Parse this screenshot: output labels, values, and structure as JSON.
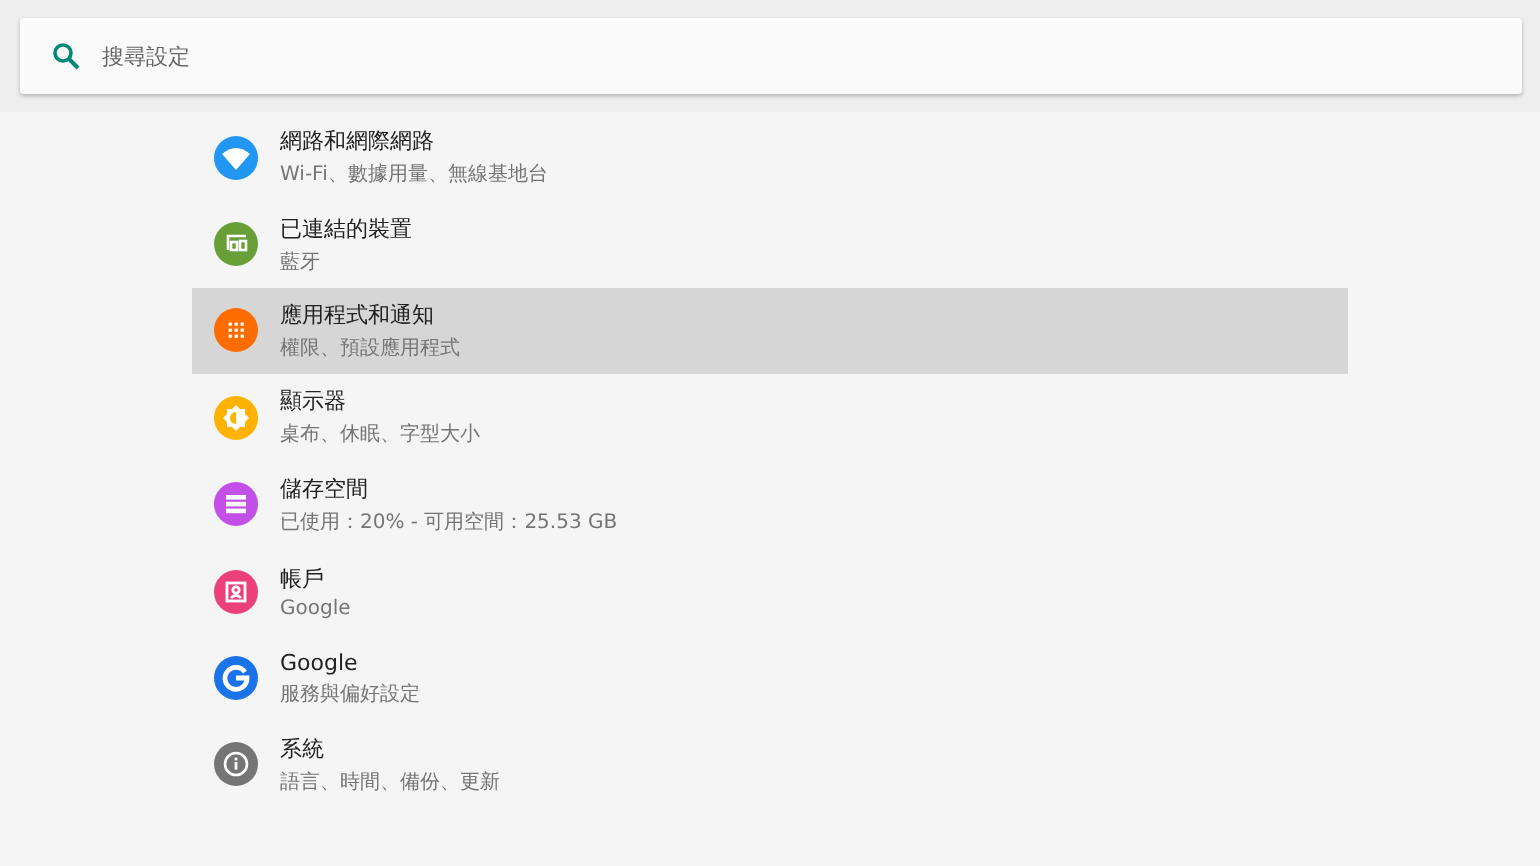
{
  "search": {
    "placeholder": "搜尋設定"
  },
  "items": [
    {
      "kind": "wifi",
      "color": "#2196f3",
      "title": "網路和網際網路",
      "subtitle": "Wi-Fi、數據用量、無線基地台",
      "selected": false
    },
    {
      "kind": "devices",
      "color": "#689f38",
      "title": "已連結的裝置",
      "subtitle": "藍牙",
      "selected": false
    },
    {
      "kind": "apps",
      "color": "#ff6d00",
      "title": "應用程式和通知",
      "subtitle": "權限、預設應用程式",
      "selected": true
    },
    {
      "kind": "display",
      "color": "#ffb300",
      "title": "顯示器",
      "subtitle": "桌布、休眠、字型大小",
      "selected": false
    },
    {
      "kind": "storage",
      "color": "#c250e8",
      "title": "儲存空間",
      "subtitle": "已使用：20% - 可用空間：25.53 GB",
      "selected": false
    },
    {
      "kind": "account",
      "color": "#ec407a",
      "title": "帳戶",
      "subtitle": "Google",
      "selected": false
    },
    {
      "kind": "google",
      "color": "#1a73e8",
      "title": "Google",
      "subtitle": "服務與偏好設定",
      "selected": false
    },
    {
      "kind": "system",
      "color": "#757575",
      "title": "系統",
      "subtitle": "語言、時間、備份、更新",
      "selected": false
    }
  ]
}
